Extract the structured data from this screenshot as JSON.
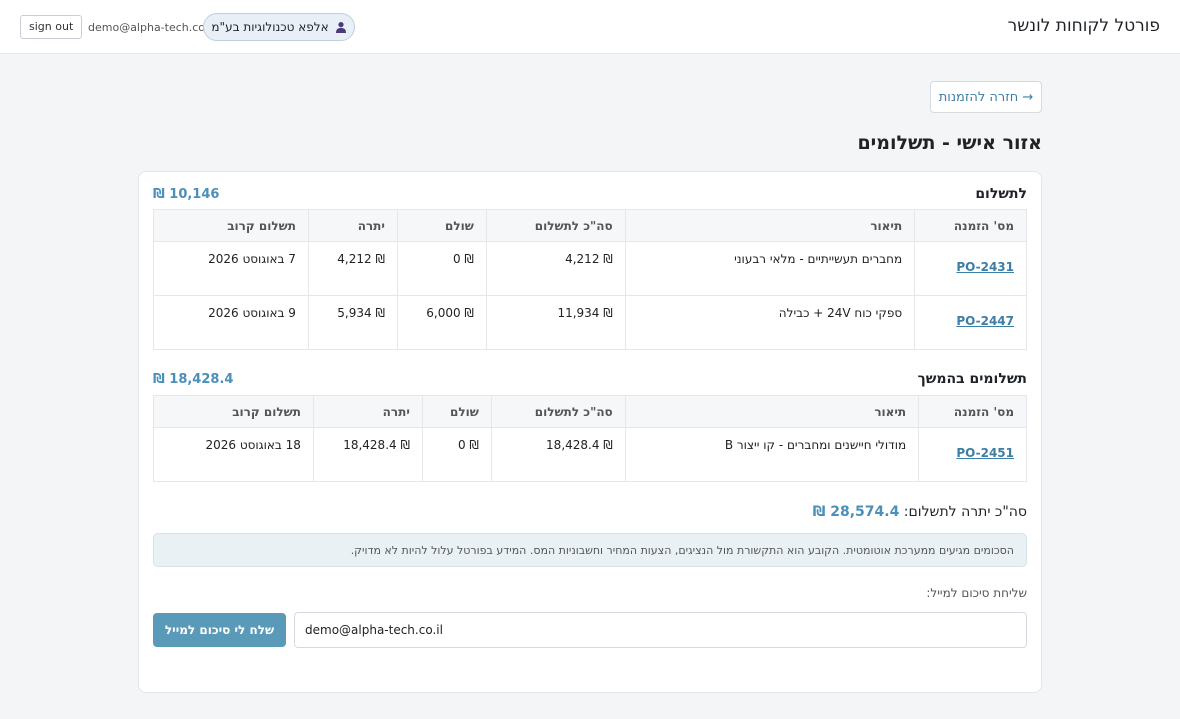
{
  "header": {
    "brand": "פורטל לקוחות לונשר",
    "company": "אלפא טכנולוגיות בע\"מ",
    "user_email": "demo@alpha-tech.co.il",
    "sign_out_label": "sign out"
  },
  "back_label": "→ חזרה להזמנות",
  "page_title": "אזור אישי - תשלומים",
  "columns": {
    "po": "מס' הזמנה",
    "desc": "תיאור",
    "total": "סה\"כ לתשלום",
    "paid": "שולם",
    "balance": "יתרה",
    "next": "תשלום קרוב"
  },
  "due": {
    "title": "לתשלום",
    "amount": "₪ 10,146",
    "rows": [
      {
        "po": "PO-2431",
        "desc": "מחברים תעשייתיים - מלאי רבעוני",
        "total": "₪ 4,212",
        "paid": "₪ 0",
        "balance": "₪ 4,212",
        "next": "7 באוגוסט 2026"
      },
      {
        "po": "PO-2447",
        "desc": "ספקי כוח 24V + כבילה",
        "total": "₪ 11,934",
        "paid": "₪ 6,000",
        "balance": "₪ 5,934",
        "next": "9 באוגוסט 2026"
      }
    ]
  },
  "upcoming": {
    "title": "תשלומים בהמשך",
    "amount": "₪ 18,428.4",
    "rows": [
      {
        "po": "PO-2451",
        "desc": "מודולי חיישנים ומחברים - קו ייצור B",
        "total": "₪ 18,428.4",
        "paid": "₪ 0",
        "balance": "₪ 18,428.4",
        "next": "18 באוגוסט 2026"
      }
    ]
  },
  "total": {
    "label": "סה\"כ יתרה לתשלום:",
    "amount": "₪ 28,574.4"
  },
  "notice": "הסכומים מגיעים ממערכת אוטומטית. הקובע הוא התקשורת מול הנציגים, הצעות המחיר וחשבוניות המס. המידע בפורטל עלול להיות לא מדויק.",
  "email_form": {
    "label": "שליחת סיכום למייל:",
    "value": "demo@alpha-tech.co.il",
    "button": "שלח לי סיכום למייל"
  }
}
